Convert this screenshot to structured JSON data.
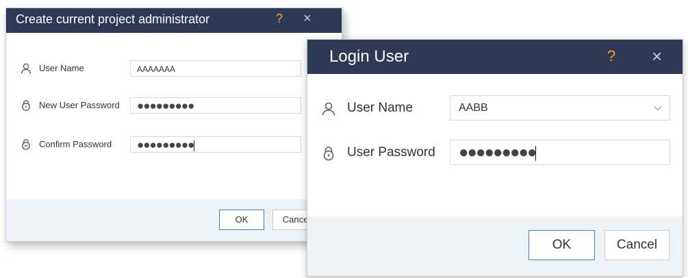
{
  "admin_dialog": {
    "title": "Create current project administrator",
    "help_glyph": "?",
    "close_glyph": "×",
    "fields": [
      {
        "label": "User Name",
        "value": "AAAAAAA",
        "icon": "user-icon"
      },
      {
        "label": "New User Password",
        "value": "●●●●●●●●●",
        "icon": "lock-icon"
      },
      {
        "label": "Confirm Password",
        "value": "●●●●●●●●●",
        "icon": "confirm-lock-icon"
      }
    ],
    "ok_label": "OK",
    "cancel_label": "Cancel"
  },
  "login_dialog": {
    "title": "Login User",
    "help_glyph": "?",
    "close_glyph": "×",
    "user_label": "User Name",
    "user_value": "AABB",
    "password_label": "User Password",
    "password_value": "●●●●●●●●●",
    "ok_label": "OK",
    "cancel_label": "Cancel"
  },
  "colors": {
    "titlebar": "#2f3854",
    "help_accent": "#f5a623",
    "ok_border": "#3e7fd6",
    "footer_bg": "#eef1f5"
  }
}
